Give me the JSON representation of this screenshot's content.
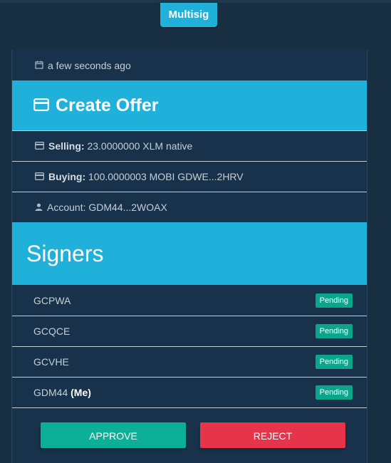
{
  "header": {
    "tag_label": "Multisig"
  },
  "transaction": {
    "timestamp": "a few seconds ago",
    "operation_title": "Create Offer",
    "selling_label": "Selling:",
    "selling_value": "23.0000000 XLM native",
    "buying_label": "Buying:",
    "buying_value": "100.0000003 MOBI GDWE...2HRV",
    "account_text": "Account: GDM44...2WOAX"
  },
  "signers": {
    "title": "Signers",
    "items": [
      {
        "name": "GCPWA",
        "me": "",
        "status": "Pending"
      },
      {
        "name": "GCQCE",
        "me": "",
        "status": "Pending"
      },
      {
        "name": "GCVHE",
        "me": "",
        "status": "Pending"
      },
      {
        "name": "GDM44",
        "me": "(Me)",
        "status": "Pending"
      }
    ]
  },
  "actions": {
    "approve_label": "APPROVE",
    "reject_label": "REJECT"
  },
  "colors": {
    "accent": "#1fb1da",
    "approve": "#0caf97",
    "reject": "#e7344b",
    "pending_badge": "#0ba58c",
    "background": "#172f40"
  },
  "icons": {
    "timestamp": "calendar-icon",
    "operation": "credit-card-icon",
    "account": "user-icon"
  }
}
